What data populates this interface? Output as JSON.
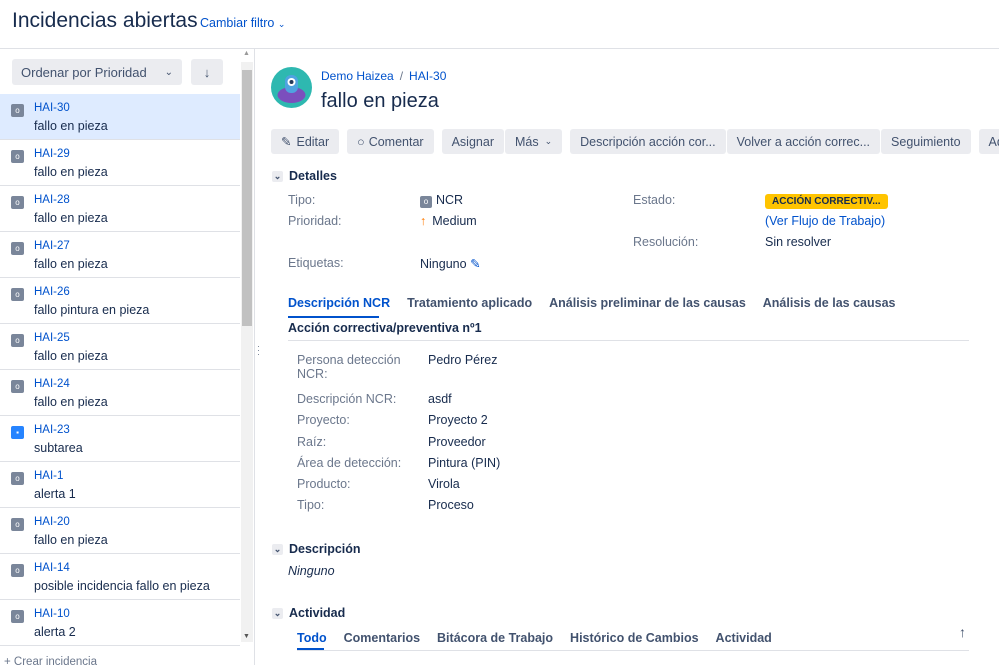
{
  "header": {
    "title": "Incidencias abiertas",
    "filter_label": "Cambiar filtro"
  },
  "sidebar": {
    "sort_label": "Ordenar por Prioridad",
    "sort_direction_icon": "arrow-down-icon",
    "create_label": "+ Crear incidencia",
    "items": [
      {
        "key": "HAI-30",
        "summary": "fallo en pieza",
        "type": "ncr"
      },
      {
        "key": "HAI-29",
        "summary": "fallo en pieza",
        "type": "ncr"
      },
      {
        "key": "HAI-28",
        "summary": "fallo en pieza",
        "type": "ncr"
      },
      {
        "key": "HAI-27",
        "summary": "fallo en pieza",
        "type": "ncr"
      },
      {
        "key": "HAI-26",
        "summary": "fallo pintura en pieza",
        "type": "ncr"
      },
      {
        "key": "HAI-25",
        "summary": "fallo en pieza",
        "type": "ncr"
      },
      {
        "key": "HAI-24",
        "summary": "fallo en pieza",
        "type": "ncr"
      },
      {
        "key": "HAI-23",
        "summary": "subtarea",
        "type": "subtask"
      },
      {
        "key": "HAI-1",
        "summary": "alerta 1",
        "type": "ncr"
      },
      {
        "key": "HAI-20",
        "summary": "fallo en pieza",
        "type": "ncr"
      },
      {
        "key": "HAI-14",
        "summary": "posible incidencia fallo en pieza",
        "type": "ncr"
      },
      {
        "key": "HAI-10",
        "summary": "alerta 2",
        "type": "ncr"
      }
    ]
  },
  "issue": {
    "project": "Demo Haizea",
    "key": "HAI-30",
    "title": "fallo en pieza",
    "buttons": {
      "edit": "Editar",
      "comment": "Comentar",
      "assign": "Asignar",
      "more": "Más",
      "t1": "Descripción acción cor...",
      "t2": "Volver a acción correc...",
      "t3": "Seguimiento",
      "t4": "Administ"
    },
    "details": {
      "heading": "Detalles",
      "type_label": "Tipo:",
      "type_value": "NCR",
      "priority_label": "Prioridad:",
      "priority_value": "Medium",
      "labels_label": "Etiquetas:",
      "labels_value": "Ninguno",
      "status_label": "Estado:",
      "status_value": "ACCIÓN CORRECTIV...",
      "workflow_link": "(Ver Flujo de Trabajo)",
      "resolution_label": "Resolución:",
      "resolution_value": "Sin resolver"
    },
    "tabs": [
      "Descripción NCR",
      "Tratamiento aplicado",
      "Análisis preliminar de las causas",
      "Análisis de las causas"
    ],
    "subheading": "Acción correctiva/preventiva nº1",
    "fields": [
      {
        "label": "Persona detección NCR:",
        "value": "Pedro Pérez"
      },
      {
        "label": "Descripción NCR:",
        "value": "asdf"
      },
      {
        "label": "Proyecto:",
        "value": "Proyecto 2"
      },
      {
        "label": "Raíz:",
        "value": "Proveedor"
      },
      {
        "label": "Área de detección:",
        "value": "Pintura (PIN)"
      },
      {
        "label": "Producto:",
        "value": "Virola"
      },
      {
        "label": "Tipo:",
        "value": "Proceso"
      }
    ],
    "description": {
      "heading": "Descripción",
      "value": "Ninguno"
    },
    "activity": {
      "heading": "Actividad",
      "tabs": [
        "Todo",
        "Comentarios",
        "Bitácora de Trabajo",
        "Histórico de Cambios",
        "Actividad"
      ]
    }
  },
  "colors": {
    "link": "#0052cc",
    "status": "#ffc400",
    "selected": "#deebff"
  }
}
